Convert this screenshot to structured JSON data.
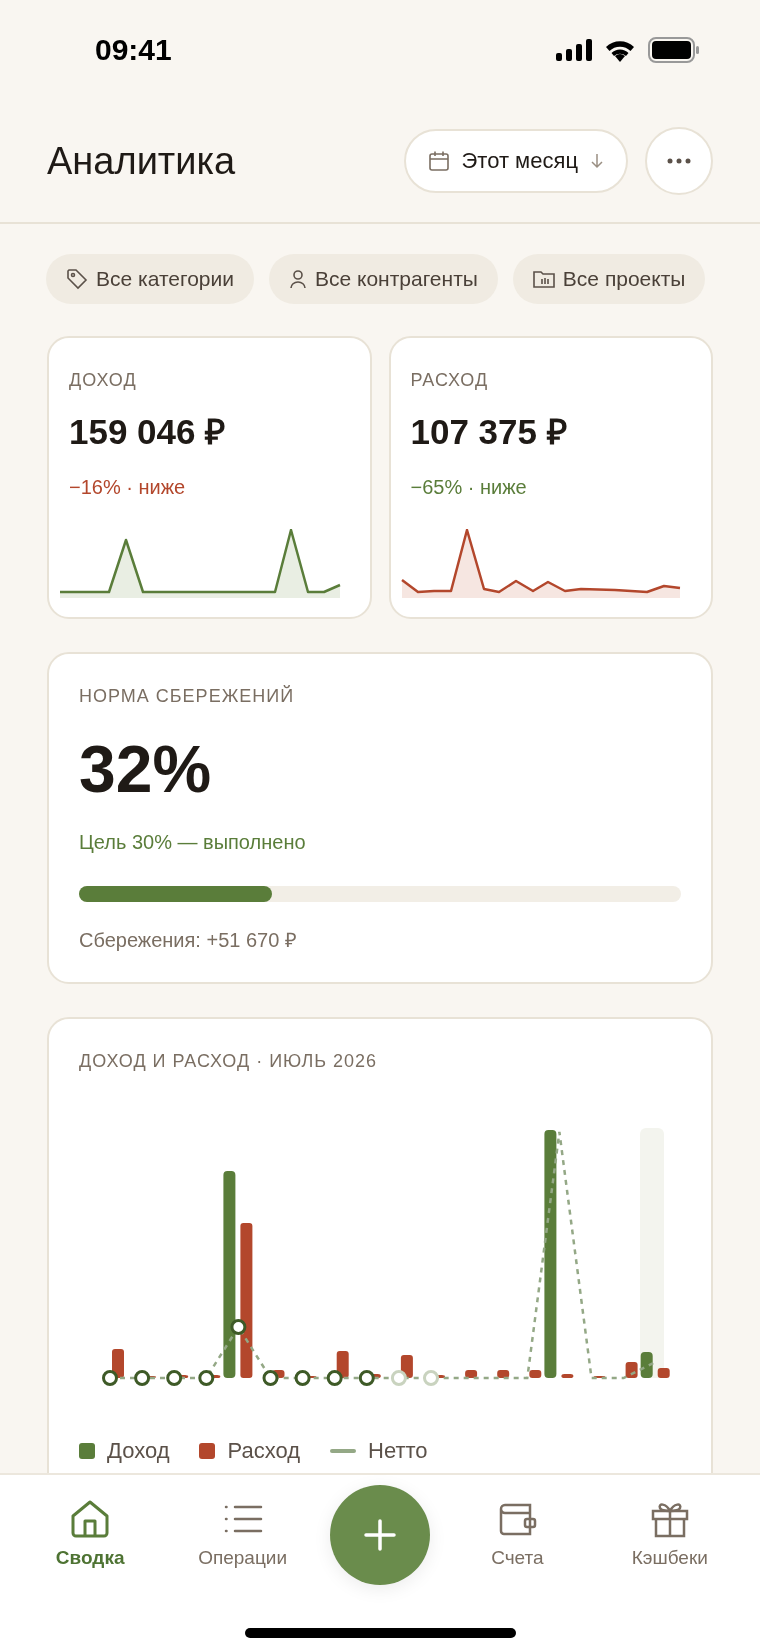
{
  "status_bar": {
    "time": "09:41"
  },
  "header": {
    "title": "Аналитика",
    "period_button": {
      "label": "Этот месяц"
    }
  },
  "filters": [
    {
      "label": "Все категории",
      "kind": "category"
    },
    {
      "label": "Все контрагенты",
      "kind": "counterparty"
    },
    {
      "label": "Все проекты",
      "kind": "project"
    }
  ],
  "summary_cards": [
    {
      "label": "ДОХОД",
      "amount": "159 046 ₽",
      "change": "−16% · ниже",
      "kind": "income"
    },
    {
      "label": "РАСХОД",
      "amount": "107 375 ₽",
      "change": "−65% · ниже",
      "kind": "expense"
    }
  ],
  "savings": {
    "label": "НОРМА СБЕРЕЖЕНИЙ",
    "value": "32%",
    "goal": "Цель 30% — выполнено",
    "level": 0.32,
    "amount": "Сбережения: +51 670 ₽"
  },
  "chart_card": {
    "title": "ДОХОД И РАСХОД · ИЮЛЬ 2026",
    "legend": [
      {
        "label": "Доход",
        "kind": "bar",
        "color": "#5a7d3a"
      },
      {
        "label": "Расход",
        "kind": "bar",
        "color": "#b3472c"
      },
      {
        "label": "Нетто",
        "kind": "line",
        "color": "#94a886"
      }
    ]
  },
  "nav": {
    "items": [
      {
        "label": "Сводка",
        "kind": "home",
        "selected": true
      },
      {
        "label": "Операции",
        "kind": "list",
        "selected": false
      },
      {
        "label": "Счета",
        "kind": "wallet",
        "selected": false
      },
      {
        "label": "Кэшбеки",
        "kind": "gift",
        "selected": false
      }
    ]
  }
}
